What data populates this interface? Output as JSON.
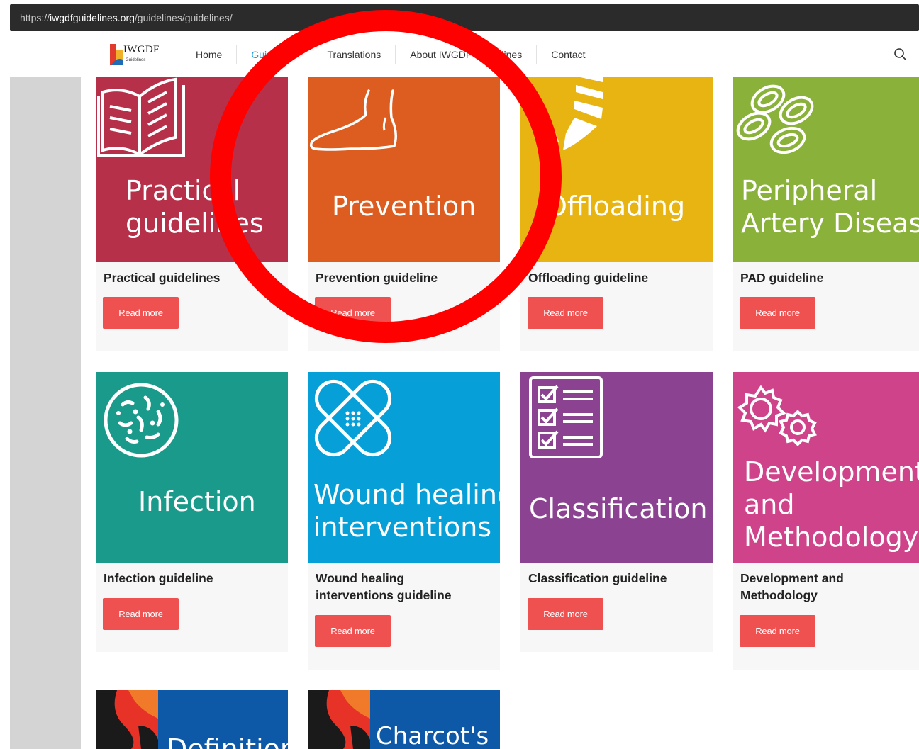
{
  "browser": {
    "url_prefix": "https://",
    "url_domain": "iwgdfguidelines.org",
    "url_path": "/guidelines/guidelines/"
  },
  "nav": {
    "logo_text": "IWGDF",
    "logo_sub": "Guidelines",
    "items": [
      {
        "label": "Home",
        "active": false
      },
      {
        "label": "Guidelines",
        "active": true
      },
      {
        "label": "Translations",
        "active": false
      },
      {
        "label": "About IWGDF-Guidelines",
        "active": false
      },
      {
        "label": "Contact",
        "active": false
      }
    ]
  },
  "cards": [
    {
      "img_title_1": "Practical",
      "img_title_2": "guidelines",
      "title": "Practical guidelines",
      "button": "Read more",
      "color": "#b7304a",
      "icon": "book-icon"
    },
    {
      "img_title_1": "Prevention",
      "title": "Prevention guideline",
      "button": "Read more",
      "color": "#dc5d1f",
      "icon": "foot-icon"
    },
    {
      "img_title_1": "Offloading",
      "title": "Offloading guideline",
      "button": "Read more",
      "color": "#e7b411",
      "icon": "cast-icon"
    },
    {
      "img_title_1": "Peripheral",
      "img_title_2": "Artery Disease",
      "title": "PAD guideline",
      "button": "Read more",
      "color": "#8ab23a",
      "icon": "blood-cells-icon"
    },
    {
      "img_title_1": "Infection",
      "title": "Infection guideline",
      "button": "Read more",
      "color": "#1a9a8a",
      "icon": "bacteria-icon"
    },
    {
      "img_title_1": "Wound healing",
      "img_title_2": "interventions",
      "title_1": "Wound healing",
      "title_2": "interventions guideline",
      "button": "Read more",
      "color": "#079fd8",
      "icon": "bandage-icon"
    },
    {
      "img_title_1": "Classification",
      "title": "Classification guideline",
      "button": "Read more",
      "color": "#8a4291",
      "icon": "checklist-icon"
    },
    {
      "img_title_1": "Development",
      "img_title_2": "and",
      "img_title_3": "Methodology",
      "title_1": "Development and",
      "title_2": "Methodology",
      "button": "Read more",
      "color": "#cf438a",
      "icon": "gears-icon"
    },
    {
      "img_title_1": "Definitions",
      "color": "#0d59a8",
      "icon": "abstract-pattern-icon"
    },
    {
      "img_title_1": "Charcot's",
      "color": "#0d59a8",
      "icon": "abstract-pattern-icon"
    }
  ],
  "colors": {
    "accent": "#1f9bd6",
    "button": "#ef5151",
    "annotation_circle": "#ff0000"
  }
}
